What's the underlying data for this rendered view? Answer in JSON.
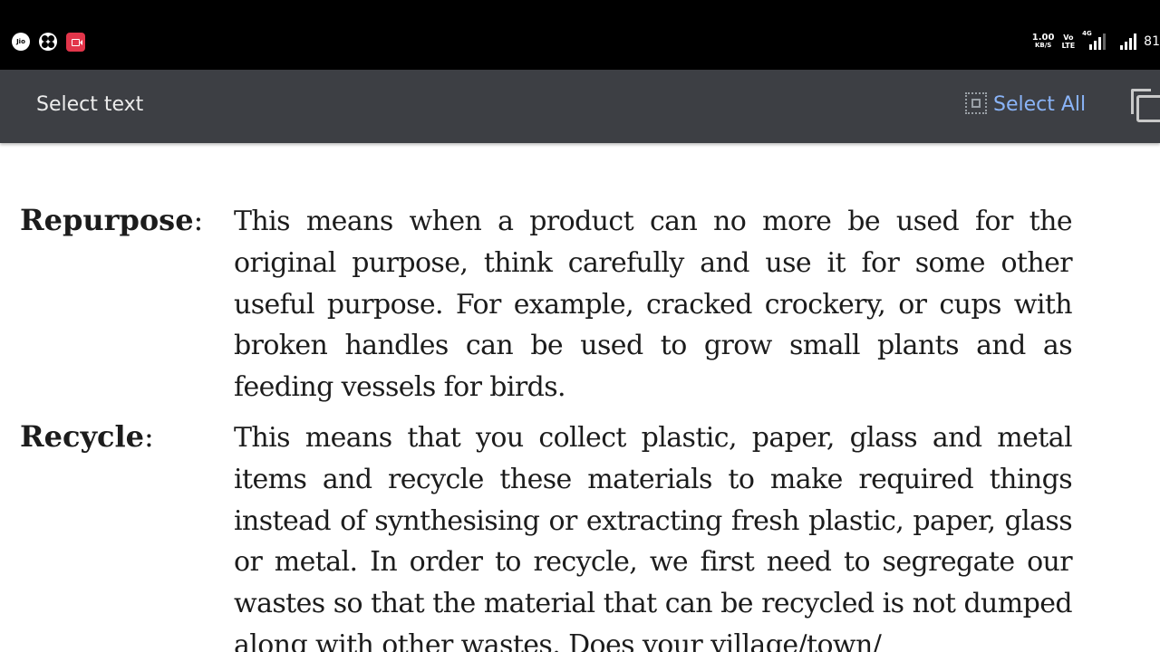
{
  "status_bar": {
    "left_icons": [
      "jio-icon",
      "fan-icon",
      "screen-recorder-icon"
    ],
    "jio_label": "Jio",
    "net_speed_value": "1.00",
    "net_speed_unit": "KB/S",
    "volte_top": "Vo",
    "volte_bottom": "LTE",
    "network_type": "4G",
    "battery": "81"
  },
  "action_bar": {
    "title": "Select text",
    "select_all_label": "Select All",
    "select_all_color": "#8ab4f8"
  },
  "document": {
    "entries": [
      {
        "term": "Repurpose",
        "colon": ":",
        "text": "This means when a product can no more be used for the original purpose, think carefully and use it for some other useful purpose. For example, cracked crockery, or cups with broken handles can be used to grow small plants and as feeding vessels for birds."
      },
      {
        "term": "Recycle",
        "colon": ":",
        "text": "This means that you collect plastic, paper, glass and metal items and recycle these materials to make required things instead of synthesising or extracting fresh plastic, paper, glass or metal. In order to recycle, we first need to segregate our wastes so that the material that can be recycled is not dumped along with other wastes. Does your village/town/"
      }
    ]
  }
}
